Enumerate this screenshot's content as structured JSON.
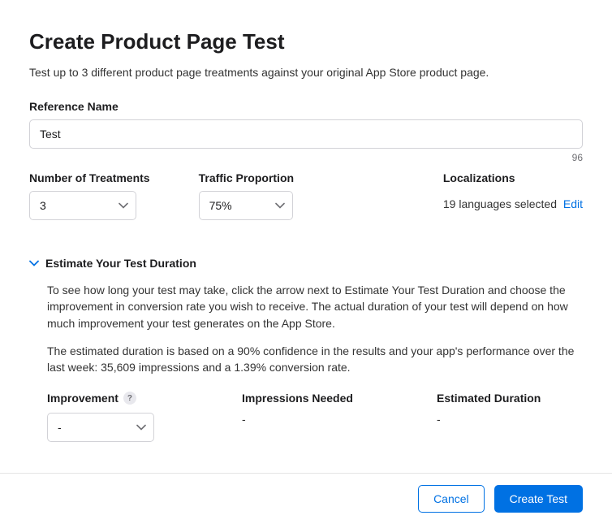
{
  "header": {
    "title": "Create Product Page Test",
    "subtitle": "Test up to 3 different product page treatments against your original App Store product page."
  },
  "reference": {
    "label": "Reference Name",
    "value": "Test",
    "remaining": "96"
  },
  "treatments": {
    "label": "Number of Treatments",
    "value": "3"
  },
  "traffic": {
    "label": "Traffic Proportion",
    "value": "75%"
  },
  "localizations": {
    "label": "Localizations",
    "text": "19 languages selected",
    "edit": "Edit"
  },
  "estimate": {
    "title": "Estimate Your Test Duration",
    "para1": "To see how long your test may take, click the arrow next to Estimate Your Test Duration and choose the improvement in conversion rate you wish to receive. The actual duration of your test will depend on how much improvement your test generates on the App Store.",
    "para2": "The estimated duration is based on a 90% confidence in the results and your app's performance over the last week: 35,609 impressions and a 1.39% conversion rate.",
    "improvement": {
      "label": "Improvement",
      "value": "-"
    },
    "impressions": {
      "label": "Impressions Needed",
      "value": "-"
    },
    "duration": {
      "label": "Estimated Duration",
      "value": "-"
    }
  },
  "footer": {
    "cancel": "Cancel",
    "create": "Create Test"
  }
}
